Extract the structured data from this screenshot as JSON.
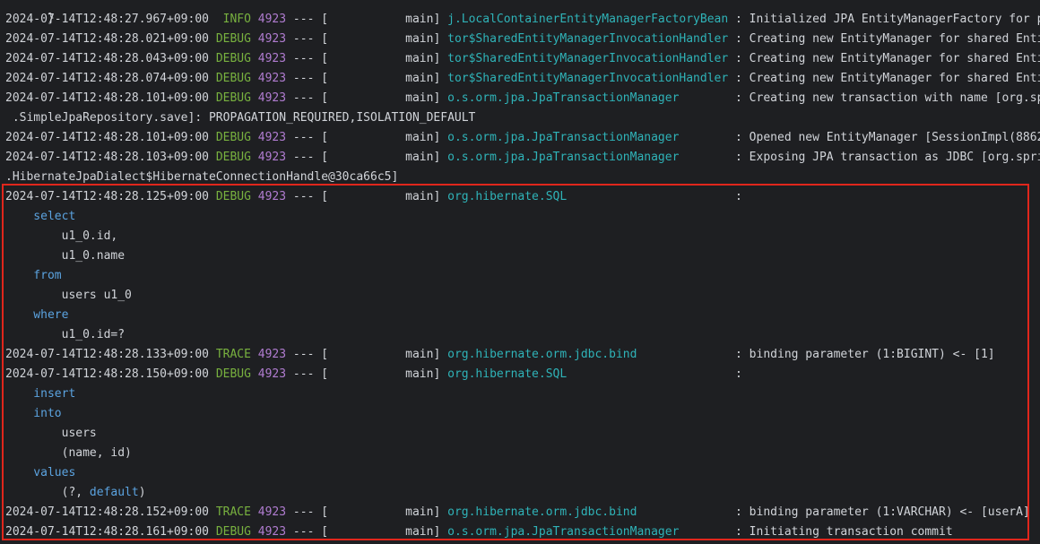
{
  "console": {
    "top_fragment": "  }",
    "lines": [
      {
        "ts": "2024-07-14T12:48:27.967+09:00",
        "level": " INFO",
        "pid": "4923",
        "sep": " --- [",
        "thread": "           main] ",
        "logger": "j.LocalContainerEntityManagerFactoryBean",
        "msg": " : Initialized JPA EntityManagerFactory for p"
      },
      {
        "ts": "2024-07-14T12:48:28.021+09:00",
        "level": "DEBUG",
        "pid": "4923",
        "sep": " --- [",
        "thread": "           main] ",
        "logger": "tor$SharedEntityManagerInvocationHandler",
        "msg": " : Creating new EntityManager for shared Enti"
      },
      {
        "ts": "2024-07-14T12:48:28.043+09:00",
        "level": "DEBUG",
        "pid": "4923",
        "sep": " --- [",
        "thread": "           main] ",
        "logger": "tor$SharedEntityManagerInvocationHandler",
        "msg": " : Creating new EntityManager for shared Enti"
      },
      {
        "ts": "2024-07-14T12:48:28.074+09:00",
        "level": "DEBUG",
        "pid": "4923",
        "sep": " --- [",
        "thread": "           main] ",
        "logger": "tor$SharedEntityManagerInvocationHandler",
        "msg": " : Creating new EntityManager for shared Enti"
      },
      {
        "ts": "2024-07-14T12:48:28.101+09:00",
        "level": "DEBUG",
        "pid": "4923",
        "sep": " --- [",
        "thread": "           main] ",
        "logger": "o.s.orm.jpa.JpaTransactionManager       ",
        "msg": " : Creating new transaction with name [org.sp"
      },
      {
        "plain": " .SimpleJpaRepository.save]: PROPAGATION_REQUIRED,ISOLATION_DEFAULT"
      },
      {
        "ts": "2024-07-14T12:48:28.101+09:00",
        "level": "DEBUG",
        "pid": "4923",
        "sep": " --- [",
        "thread": "           main] ",
        "logger": "o.s.orm.jpa.JpaTransactionManager       ",
        "msg": " : Opened new EntityManager [SessionImpl(8862"
      },
      {
        "ts": "2024-07-14T12:48:28.103+09:00",
        "level": "DEBUG",
        "pid": "4923",
        "sep": " --- [",
        "thread": "           main] ",
        "logger": "o.s.orm.jpa.JpaTransactionManager       ",
        "msg": " : Exposing JPA transaction as JDBC [org.spri"
      },
      {
        "plain": ".HibernateJpaDialect$HibernateConnectionHandle@30ca66c5]"
      },
      {
        "ts": "2024-07-14T12:48:28.125+09:00",
        "level": "DEBUG",
        "pid": "4923",
        "sep": " --- [",
        "thread": "           main] ",
        "logger": "org.hibernate.SQL                       ",
        "msg": " :"
      },
      {
        "sqlkw": "    select"
      },
      {
        "plain": "        u1_0.id,"
      },
      {
        "plain": "        u1_0.name"
      },
      {
        "sqlkw": "    from"
      },
      {
        "plain": "        users u1_0"
      },
      {
        "sqlkw": "    where"
      },
      {
        "plain": "        u1_0.id=?"
      },
      {
        "ts": "2024-07-14T12:48:28.133+09:00",
        "level": "TRACE",
        "pid": "4923",
        "sep": " --- [",
        "thread": "           main] ",
        "logger": "org.hibernate.orm.jdbc.bind             ",
        "msg": " : binding parameter (1:BIGINT) <- [1]"
      },
      {
        "ts": "2024-07-14T12:48:28.150+09:00",
        "level": "DEBUG",
        "pid": "4923",
        "sep": " --- [",
        "thread": "           main] ",
        "logger": "org.hibernate.SQL                       ",
        "msg": " :"
      },
      {
        "sqlkw": "    insert"
      },
      {
        "sqlkw": "    into"
      },
      {
        "plain": "        users"
      },
      {
        "plain": "        (name, id)"
      },
      {
        "sqlkw": "    values"
      },
      {
        "plain": "        (?, ",
        "kw2": "default",
        "tail": ")"
      },
      {
        "ts": "2024-07-14T12:48:28.152+09:00",
        "level": "TRACE",
        "pid": "4923",
        "sep": " --- [",
        "thread": "           main] ",
        "logger": "org.hibernate.orm.jdbc.bind             ",
        "msg": " : binding parameter (1:VARCHAR) <- [userA]"
      },
      {
        "ts": "2024-07-14T12:48:28.161+09:00",
        "level": "DEBUG",
        "pid": "4923",
        "sep": " --- [",
        "thread": "           main] ",
        "logger": "o.s.orm.jpa.JpaTransactionManager       ",
        "msg": " : Initiating transaction commit"
      }
    ]
  },
  "colors": {
    "background": "#1e1f22",
    "text": "#d1d4d9",
    "level": "#78b13f",
    "pid": "#b07cd0",
    "logger": "#2fb3b8",
    "sql_keyword": "#5ba3e0",
    "highlight_border": "#e0261c"
  }
}
